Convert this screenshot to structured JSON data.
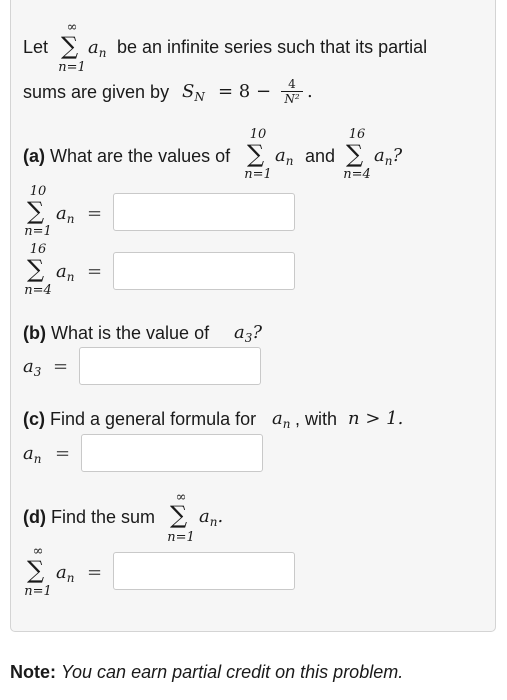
{
  "intro": {
    "let": "Let",
    "sum_upper": "∞",
    "sum_lower": "n=1",
    "term": "a",
    "term_sub": "n",
    "rest1": "be an infinite series such that its partial",
    "rest2": "sums are given by",
    "formula_lhs": "S",
    "formula_lhs_sub": "N",
    "formula_eq": "= 8 −",
    "frac_num": "4",
    "frac_den": "N²",
    "period": "."
  },
  "part_a": {
    "label": "(a)",
    "question": "What are the values of",
    "sum1_upper": "10",
    "sum1_lower": "n=1",
    "and": "and",
    "sum2_upper": "16",
    "sum2_lower": "n=4",
    "qmark": "?",
    "row1_upper": "10",
    "row1_lower": "n=1",
    "row2_upper": "16",
    "row2_lower": "n=4",
    "eq": "="
  },
  "part_b": {
    "label": "(b)",
    "question": "What is the value of",
    "var": "a",
    "var_sub": "3",
    "qmark": "?",
    "eq": "="
  },
  "part_c": {
    "label": "(c)",
    "question": "Find a general formula for",
    "var": "a",
    "var_sub": "n",
    "with": ", with",
    "cond": "n > 1.",
    "eq": "="
  },
  "part_d": {
    "label": "(d)",
    "question": "Find the sum",
    "sum_upper": "∞",
    "sum_lower": "n=1",
    "period": ".",
    "row_upper": "∞",
    "row_lower": "n=1",
    "eq": "="
  },
  "sigma": "∑",
  "note": {
    "label": "Note:",
    "text": "You can earn partial credit on this problem."
  }
}
